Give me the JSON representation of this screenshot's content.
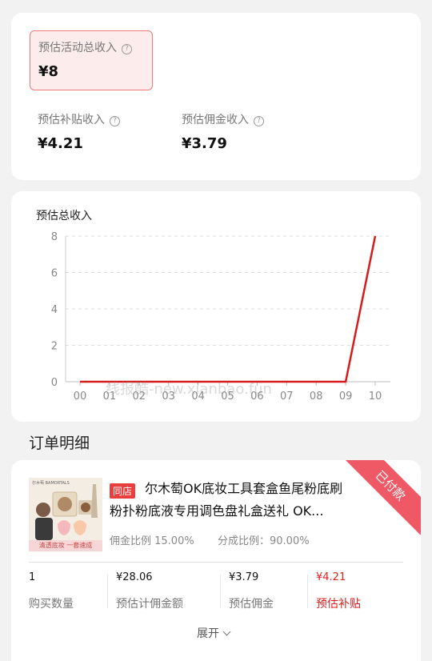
{
  "summary": {
    "total_label": "预估活动总收入",
    "total_value": "¥8",
    "subsidy_label": "预估补贴收入",
    "subsidy_value": "¥4.21",
    "commission_label": "预估佣金收入",
    "commission_value": "¥3.79",
    "help_glyph": "?"
  },
  "chart_data": {
    "type": "line",
    "title": "预估总收入",
    "categories": [
      "00",
      "01",
      "02",
      "03",
      "04",
      "05",
      "06",
      "07",
      "08",
      "09",
      "10"
    ],
    "values": [
      0,
      0,
      0,
      0,
      0,
      0,
      0,
      0,
      0,
      0,
      8
    ],
    "y_ticks": [
      0,
      2,
      4,
      6,
      8
    ],
    "ylim": [
      0,
      8
    ],
    "grid": true,
    "line_color": "#d41c1c"
  },
  "watermark": "线报酷-new.xianbao.fun",
  "orders": {
    "section_title": "订单明细",
    "item": {
      "shop_tag": "同店",
      "title": "尔木萄OK底妆工具套盒鱼尾粉底刷粉扑粉底液专用调色盘礼盒送礼 OK...",
      "commission_ratio": "佣金比例 15.00%",
      "share_ratio": "分成比例：90.00%",
      "status": "已付款",
      "thumb_top_text": "尔木萄 BAMORTALS",
      "thumb_bottom_text": "清透底妆 一套速成",
      "stats": [
        {
          "value": "1",
          "label": "购买数量"
        },
        {
          "value": "¥28.06",
          "label": "预估计佣金额"
        },
        {
          "value": "¥3.79",
          "label": "预估佣金"
        },
        {
          "value": "¥4.21",
          "label": "预估补贴"
        }
      ],
      "expand_label": "展开"
    }
  }
}
